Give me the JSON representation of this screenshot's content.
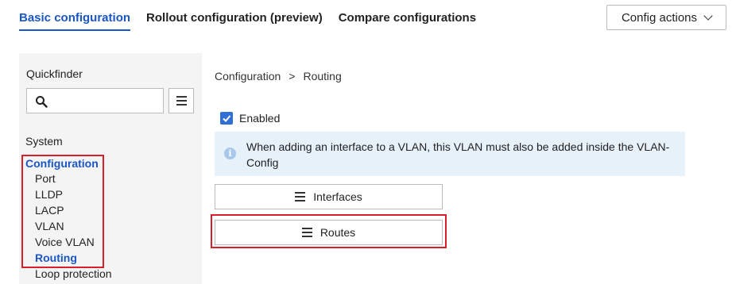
{
  "tabs": [
    {
      "label": "Basic configuration",
      "active": true
    },
    {
      "label": "Rollout configuration (preview)",
      "active": false
    },
    {
      "label": "Compare configurations",
      "active": false
    }
  ],
  "config_actions": {
    "label": "Config actions",
    "icon": "chevron-down-icon"
  },
  "sidebar": {
    "quickfinder_label": "Quickfinder",
    "search": {
      "value": "",
      "placeholder": ""
    },
    "system_label": "System",
    "nav": {
      "parent": "Configuration",
      "items": [
        "Port",
        "LLDP",
        "LACP",
        "VLAN",
        "Voice VLAN",
        "Routing",
        "Loop protection"
      ],
      "active": "Routing"
    }
  },
  "breadcrumb": {
    "root": "Configuration",
    "separator": ">",
    "current": "Routing"
  },
  "enabled": {
    "label": "Enabled",
    "checked": true
  },
  "info": {
    "text": "When adding an interface to a VLAN, this VLAN must also be added inside the VLAN-Config"
  },
  "sections": {
    "interfaces_label": "Interfaces",
    "routes_label": "Routes"
  },
  "colors": {
    "accent": "#1a56c4",
    "highlight": "#d6202a",
    "info_bg": "#e6f1fa"
  }
}
